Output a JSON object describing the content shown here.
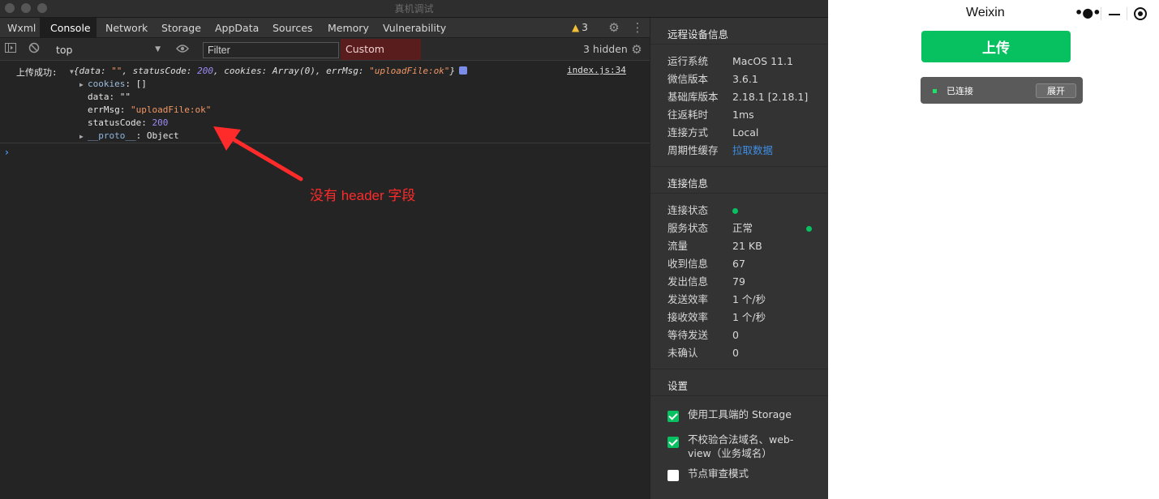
{
  "window": {
    "title": "真机调试"
  },
  "tabs": [
    "Wxml",
    "Console",
    "Network",
    "Storage",
    "AppData",
    "Sources",
    "Memory",
    "Vulnerability"
  ],
  "warnings": {
    "icon": "warning-triangle-icon",
    "count": "3"
  },
  "toolbar": {
    "context": "top",
    "filter_placeholder": "Filter",
    "levels": "Custom levels",
    "hidden": "3 hidden"
  },
  "console": {
    "label": "上传成功:",
    "summary": {
      "open": "{data: ",
      "data_val": "\"\"",
      "sc_key": ", statusCode: ",
      "sc_val": "200",
      "cookies": ", cookies: Array(0), errMsg: ",
      "err_val": "\"uploadFile:ok\"",
      "close": "}"
    },
    "source": "index.js:34",
    "props": {
      "cookies_key": "cookies",
      "cookies_val": " []",
      "data_key": "data",
      "data_val": " \"\"",
      "errmsg_key": "errMsg",
      "errmsg_val": "\"uploadFile:ok\"",
      "sc_key": "statusCode",
      "sc_val": "200",
      "proto_key": "__proto__",
      "proto_val": " Object"
    },
    "annotation": "没有 header 字段"
  },
  "info": {
    "device_title": "远程设备信息",
    "device": [
      {
        "k": "运行系统",
        "v": "MacOS 11.1"
      },
      {
        "k": "微信版本",
        "v": "3.6.1"
      },
      {
        "k": "基础库版本",
        "v": "2.18.1 [2.18.1]"
      },
      {
        "k": "往返耗时",
        "v": "1ms"
      },
      {
        "k": "连接方式",
        "v": "Local"
      },
      {
        "k": "周期性缓存",
        "v": "拉取数据"
      }
    ],
    "conn_title": "连接信息",
    "conn": [
      {
        "k": "连接状态",
        "v": ""
      },
      {
        "k": "服务状态",
        "v": "正常"
      },
      {
        "k": "流量",
        "v": "21 KB"
      },
      {
        "k": "收到信息",
        "v": "67"
      },
      {
        "k": "发出信息",
        "v": "79"
      },
      {
        "k": "发送效率",
        "v": "1 个/秒"
      },
      {
        "k": "接收效率",
        "v": "1 个/秒"
      },
      {
        "k": "等待发送",
        "v": "0"
      },
      {
        "k": "未确认",
        "v": "0"
      }
    ],
    "settings_title": "设置",
    "settings": [
      {
        "label": "使用工具端的 Storage",
        "checked": true
      },
      {
        "label": "不校验合法域名、web-view（业务域名）",
        "checked": true
      },
      {
        "label": "节点审查模式",
        "checked": false
      }
    ]
  },
  "simulator": {
    "nav_title": "Weixin",
    "upload_label": "上传",
    "conn_label": "已连接",
    "expand_label": "展开"
  },
  "colors": {
    "accent": "#07c160",
    "annotation": "#ff2a2a",
    "levels_bg": "#5a1d1d"
  }
}
